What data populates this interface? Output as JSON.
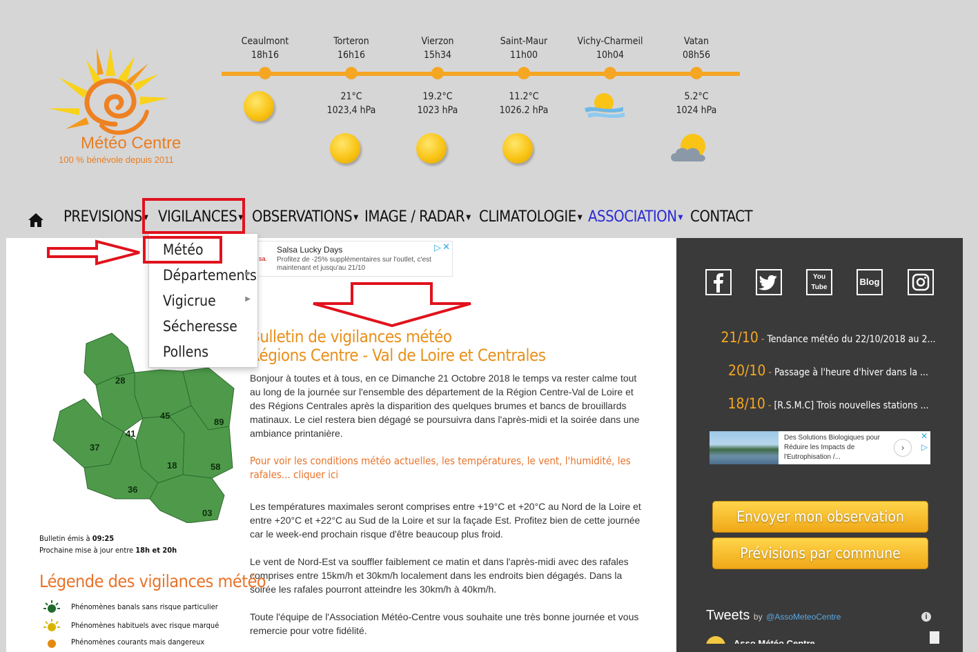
{
  "logo": {
    "brand": "Météo Centre",
    "tagline": "100 % bénévole depuis 2011"
  },
  "stations": [
    {
      "name": "Ceaulmont",
      "time": "18h16",
      "temp": "",
      "pressure": "",
      "icon": "sun-icon"
    },
    {
      "name": "Torteron",
      "time": "16h16",
      "temp": "21°C",
      "pressure": "1023,4 hPa",
      "icon": "sun-icon"
    },
    {
      "name": "Vierzon",
      "time": "15h34",
      "temp": "19.2°C",
      "pressure": "1023 hPa",
      "icon": "sun-icon"
    },
    {
      "name": "Saint-Maur",
      "time": "11h00",
      "temp": "11.2°C",
      "pressure": "1026.2 hPa",
      "icon": "sun-icon"
    },
    {
      "name": "Vichy-Charmeil",
      "time": "10h04",
      "temp": "",
      "pressure": "",
      "icon": "fog-icon"
    },
    {
      "name": "Vatan",
      "time": "08h56",
      "temp": "5.2°C",
      "pressure": "1024 hPa",
      "icon": "cloud-sun-icon"
    }
  ],
  "nav": {
    "previsions": "PREVISIONS",
    "vigilances": "VIGILANCES",
    "observations": "OBSERVATIONS",
    "image_radar": "IMAGE / RADAR",
    "climatologie": "CLIMATOLOGIE",
    "association": "ASSOCIATION",
    "contact": "CONTACT"
  },
  "dropdown": {
    "meteo": "Météo",
    "departements": "Départements",
    "vigicrue": "Vigicrue",
    "secheresse": "Sécheresse",
    "pollens": "Pollens"
  },
  "ad1": {
    "title": "Salsa Lucky Days",
    "desc": "Profitez de -25% supplémentaires sur l'outlet, c'est maintenant et jusqu'au 21/10",
    "brand": "sa."
  },
  "bulletin": {
    "title1": "Bulletin de vigilances météo",
    "title2": "Régions Centre - Val de Loire et Centrales",
    "p1": "Bonjour à toutes et à tous, en ce Dimanche 21 Octobre 2018 le temps va rester calme tout au long de la journée sur l'ensemble des département de la Région Centre-Val de Loire et des Régions Centrales après la disparition des quelques brumes et bancs de brouillards matinaux. Le ciel restera bien dégagé se poursuivra dans l'après-midi et la soirée dans une ambiance printanière.",
    "link": "Pour voir les conditions météo actuelles, les températures, le vent, l'humidité, les rafales... cliquer ici",
    "p2": "Les températures maximales seront comprises entre +19°C et +20°C au Nord de la Loire et entre +20°C et +22°C au Sud de la Loire et sur la façade Est. Profitez bien de cette journée car le week-end prochain risque d'être beaucoup plus froid.",
    "p3": "Le vent de Nord-Est va souffler faiblement ce matin et dans l'après-midi avec des rafales comprises entre 15km/h et 30km/h localement dans les endroits bien dégagés. Dans la soirée les rafales pourront atteindre les 30km/h à 40km/h.",
    "p4": "Toute l'équipe de l'Association Météo-Centre vous souhaite une très bonne journée et vous remercie pour votre fidélité."
  },
  "map": {
    "labels": [
      "28",
      "45",
      "89",
      "41",
      "37",
      "18",
      "58",
      "36",
      "03"
    ]
  },
  "issued": {
    "label": "Bulletin émis à ",
    "time": "09:25",
    "next_label": "Prochaine mise à jour entre ",
    "next_time": "18h et 20h"
  },
  "legend": {
    "title": "Légende des vigilances météo",
    "rows": [
      "Phénomènes banals sans risque particulier",
      "Phénomènes habituels avec risque marqué",
      "Phénomènes courants mais dangereux"
    ]
  },
  "sidebar": {
    "social": [
      "facebook-icon",
      "twitter-icon",
      "youtube-icon",
      "blog-icon",
      "instagram-icon"
    ],
    "youtube_text": "You Tube",
    "blog_text": "Blog",
    "news": [
      {
        "date": "21/10",
        "text": "Tendance météo du 22/10/2018 au 2..."
      },
      {
        "date": "20/10",
        "text": "Passage à l'heure d'hiver dans la ..."
      },
      {
        "date": "18/10",
        "text": "[R.S.M.C] Trois nouvelles stations ..."
      }
    ],
    "ad2": "Des Solutions Biologiques pour Réduire les Impacts de l'Eutrophisation /...",
    "btn_observation": "Envoyer mon observation",
    "btn_previsions": "Prévisions par commune",
    "tweets_title": "Tweets",
    "tweets_by": "by",
    "tweets_handle": "@AssoMeteoCentre",
    "tweet_author": "Asso Météo Centre"
  },
  "colors": {
    "accent": "#f5a623",
    "highlight": "#e0121d",
    "map_green": "#4e9a4a"
  }
}
